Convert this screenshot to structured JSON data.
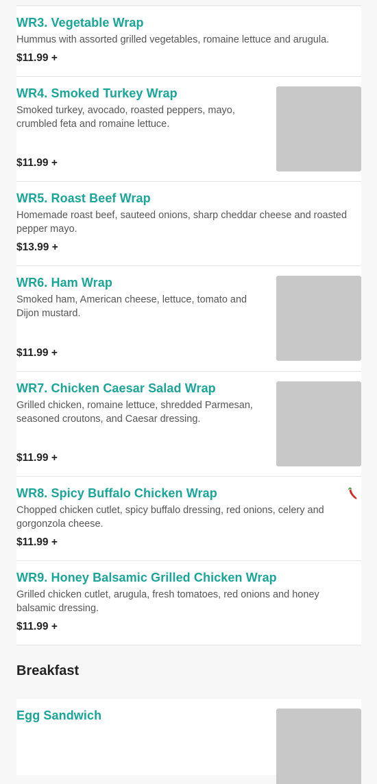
{
  "items": [
    {
      "name": "WR3. Vegetable Wrap",
      "description": "Hummus with assorted grilled vegetables, romaine lettuce and arugula.",
      "price": "$11.99 +"
    },
    {
      "name": "WR4. Smoked Turkey Wrap",
      "description": "Smoked turkey, avocado, roasted peppers, mayo, crumbled feta and romaine lettuce.",
      "price": "$11.99 +"
    },
    {
      "name": "WR5. Roast Beef Wrap",
      "description": "Homemade roast beef, sauteed onions, sharp cheddar cheese and roasted pepper mayo.",
      "price": "$13.99 +"
    },
    {
      "name": "WR6. Ham Wrap",
      "description": "Smoked ham, American cheese, lettuce, tomato and Dijon mustard.",
      "price": "$11.99 +"
    },
    {
      "name": "WR7. Chicken Caesar Salad Wrap",
      "description": "Grilled chicken, romaine lettuce, shredded Parmesan, seasoned croutons, and Caesar dressing.",
      "price": "$11.99 +"
    },
    {
      "name": "WR8. Spicy Buffalo Chicken Wrap",
      "description": "Chopped chicken cutlet, spicy buffalo dressing, red onions, celery and gorgonzola cheese.",
      "price": "$11.99 +",
      "icon": "chili-pepper-icon"
    },
    {
      "name": "WR9. Honey Balsamic Grilled Chicken Wrap",
      "description": "Grilled chicken cutlet, arugula, fresh tomatoes, red onions and honey balsamic dressing.",
      "price": "$11.99 +"
    }
  ],
  "breakfast": {
    "heading": "Breakfast",
    "items": [
      {
        "name": "Egg Sandwich"
      }
    ]
  },
  "colors": {
    "item_name": "#1aa599",
    "price": "#222222",
    "description": "#555555",
    "placeholder": "#c8c8c9",
    "divider": "#e3e3e3",
    "background": "#f7f7f7",
    "chili": "#d42a2a"
  }
}
